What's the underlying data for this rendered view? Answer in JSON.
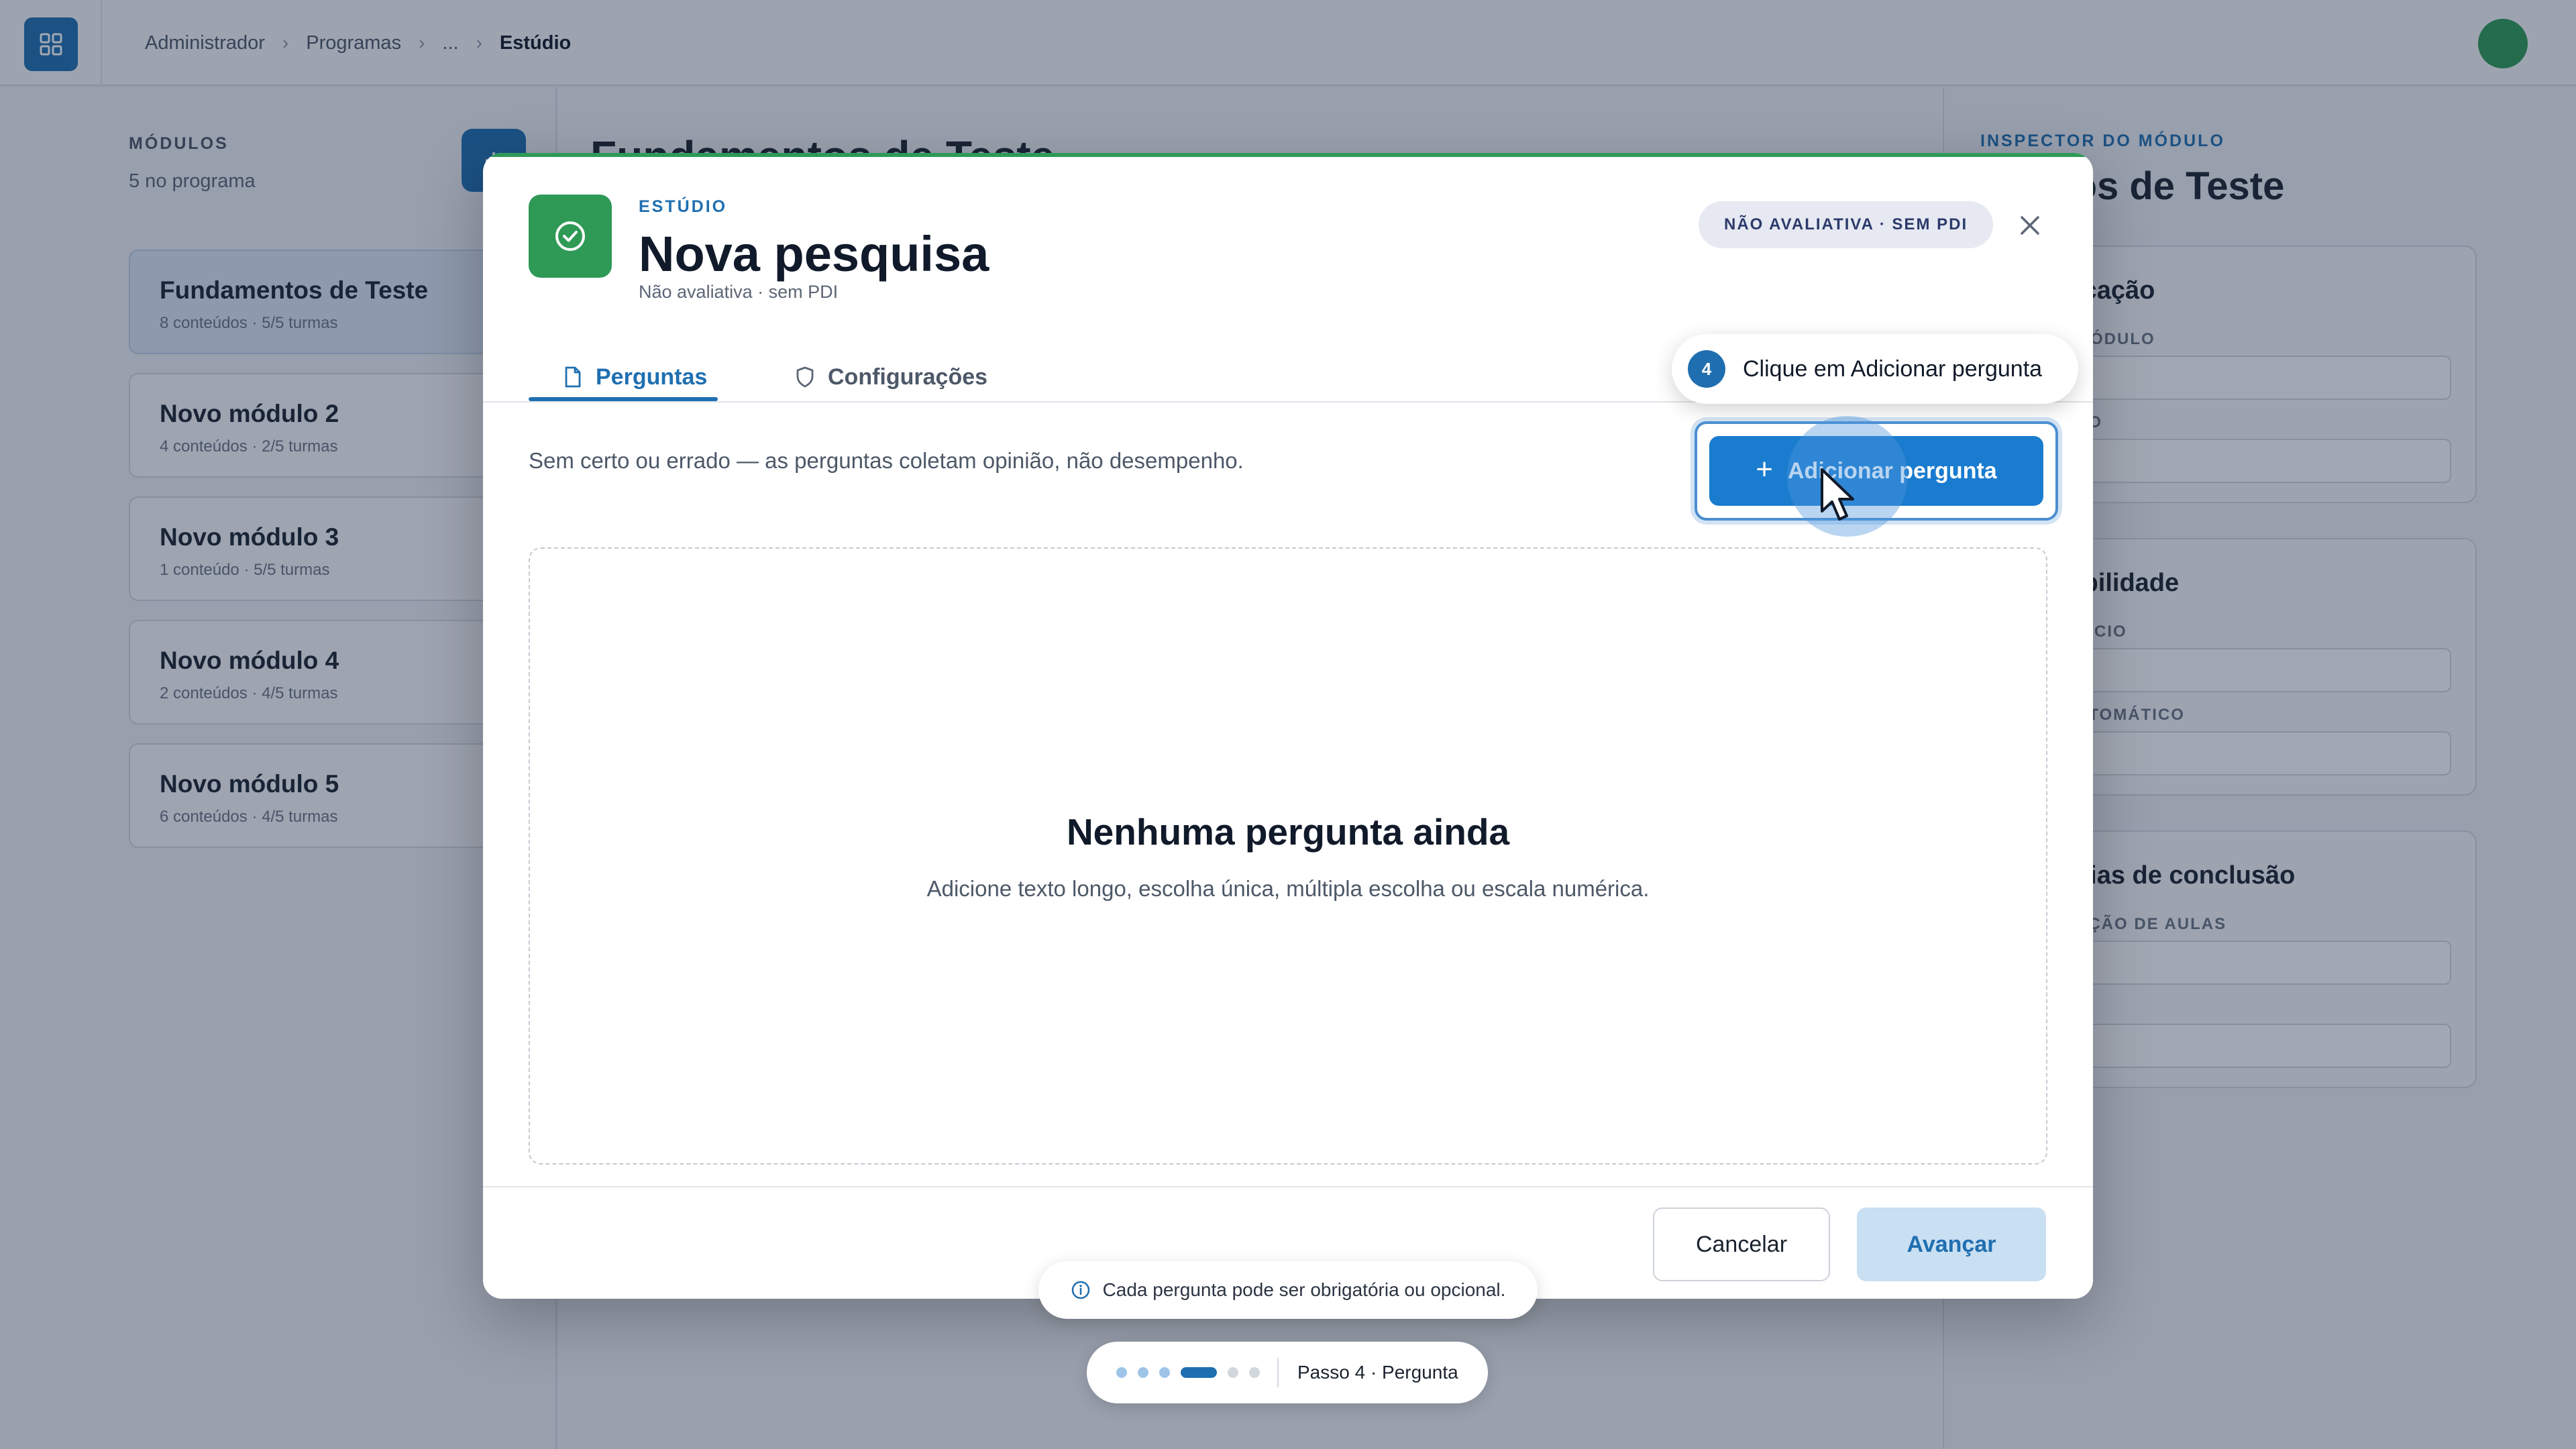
{
  "topbar": {
    "breadcrumb": [
      "Administrador",
      "Programas",
      "...",
      "Estúdio"
    ]
  },
  "sidebar": {
    "heading": "MÓDULOS",
    "count": "5 no programa",
    "modules": [
      {
        "title": "Fundamentos de Teste",
        "meta": "8 conteúdos · 5/5 turmas"
      },
      {
        "title": "Novo módulo 2",
        "meta": "4 conteúdos · 2/5 turmas"
      },
      {
        "title": "Novo módulo 3",
        "meta": "1 conteúdo · 5/5 turmas"
      },
      {
        "title": "Novo módulo 4",
        "meta": "2 conteúdos · 4/5 turmas"
      },
      {
        "title": "Novo módulo 5",
        "meta": "6 conteúdos · 4/5 turmas"
      }
    ]
  },
  "center": {
    "title": "Fundamentos de Teste"
  },
  "inspector": {
    "label": "INSPECTOR DO MÓDULO",
    "title": "mentos de Teste",
    "cards": [
      {
        "title": "icação",
        "fields": [
          "MÓDULO",
          "ÃO"
        ]
      },
      {
        "title": "ibilidade",
        "fields": [
          "NÍCIO",
          "UTOMÁTICO"
        ]
      },
      {
        "title": "cias de conclusão",
        "fields": [
          "AÇÃO DE AULAS",
          ""
        ]
      }
    ]
  },
  "modal": {
    "eyebrow": "ESTÚDIO",
    "title": "Nova pesquisa",
    "subtitle": "Não avaliativa · sem PDI",
    "badge": "NÃO AVALIATIVA · SEM PDI",
    "tabs": [
      {
        "label": "Perguntas",
        "icon": "document-icon",
        "active": true
      },
      {
        "label": "Configurações",
        "icon": "shield-icon",
        "active": false
      }
    ],
    "description": "Sem certo ou errado — as perguntas coletam opinião, não desempenho.",
    "add_question_label": "Adicionar pergunta",
    "empty_title": "Nenhuma pergunta ainda",
    "empty_subtitle": "Adicione texto longo, escolha única, múltipla escolha ou escala numérica.",
    "cancel_label": "Cancelar",
    "next_label": "Avançar"
  },
  "tour": {
    "step_number": "4",
    "callout": "Clique em Adicionar pergunta",
    "hint": "Cada pergunta pode ser obrigatória ou opcional.",
    "progress_label": "Passo 4 · Pergunta",
    "total_steps": 6,
    "current_step": 4
  },
  "colors": {
    "accent": "#1f6fb0",
    "success": "#2e9a56",
    "overlay": "rgba(22,38,66,0.40)"
  }
}
